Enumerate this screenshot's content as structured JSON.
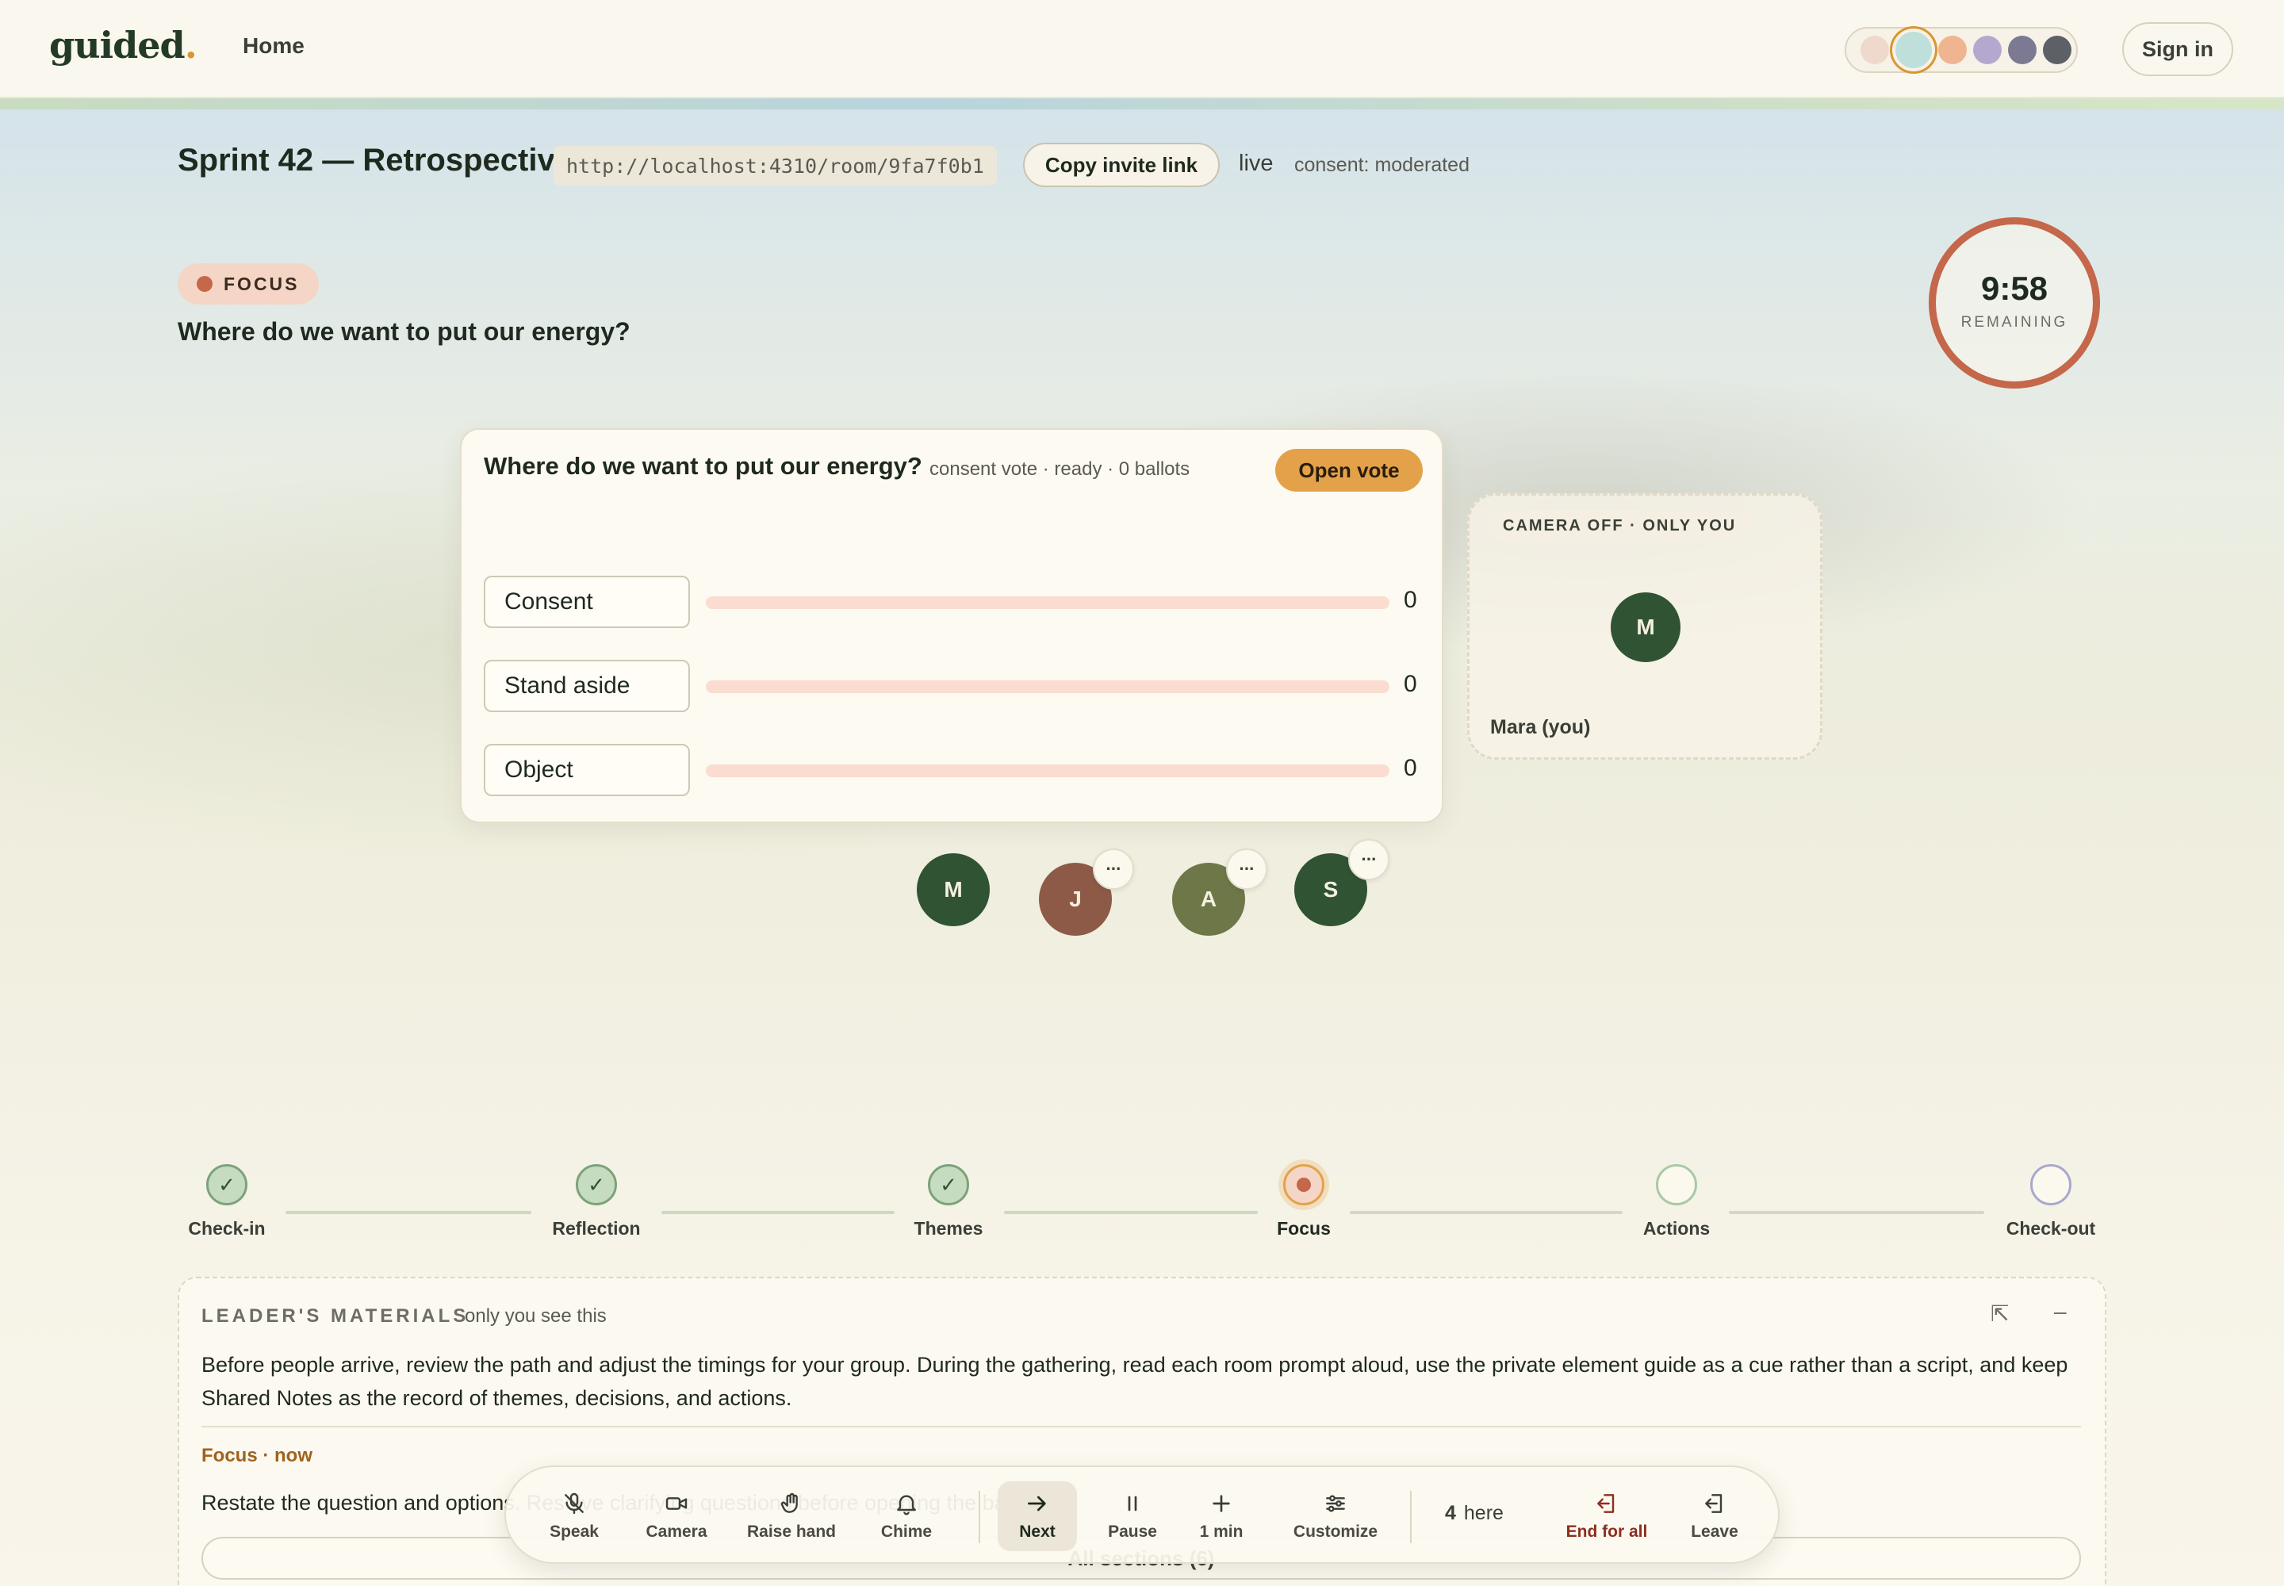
{
  "app": {
    "logo": "guided",
    "logo_dot": ".",
    "nav_home": "Home",
    "sign_in": "Sign in",
    "theme_swatches": [
      "#eed9cc",
      "#bfe0da",
      "#efb590",
      "#b5a8cf",
      "#7b7a92",
      "#5e6068"
    ],
    "active_swatch": 1
  },
  "room": {
    "title": "Sprint 42 — Retrospective",
    "url": "http://localhost:4310/room/9fa7f0b1",
    "copy_link": "Copy invite link",
    "status": "live",
    "consent_mode": "consent: moderated"
  },
  "stage": {
    "pill": "FOCUS",
    "question": "Where do we want to put our energy?",
    "timer": {
      "time": "9:58",
      "label": "REMAINING"
    }
  },
  "vote": {
    "question": "Where do we want to put our energy?",
    "meta": "consent vote · ready · 0 ballots",
    "open_button": "Open vote",
    "options": [
      {
        "label": "Consent",
        "count": "0",
        "share": 0
      },
      {
        "label": "Stand aside",
        "count": "0",
        "share": 0
      },
      {
        "label": "Object",
        "count": "0",
        "share": 0
      }
    ]
  },
  "camera": {
    "badge": "CAMERA OFF · ONLY YOU",
    "initial": "M",
    "name": "Mara (you)"
  },
  "participants": [
    {
      "initial": "M",
      "color": "#2f5333",
      "more": ""
    },
    {
      "initial": "J",
      "color": "#8d5a47",
      "more": "···"
    },
    {
      "initial": "A",
      "color": "#6d7748",
      "more": "···"
    },
    {
      "initial": "S",
      "color": "#2f5333",
      "more": "···"
    }
  ],
  "path": {
    "steps": [
      {
        "label": "Check-in",
        "state": "done",
        "mark": "✓"
      },
      {
        "label": "Reflection",
        "state": "done",
        "mark": "✓"
      },
      {
        "label": "Themes",
        "state": "done",
        "mark": "✓"
      },
      {
        "label": "Focus",
        "state": "current",
        "mark": ""
      },
      {
        "label": "Actions",
        "state": "todo",
        "mark": ""
      },
      {
        "label": "Check-out",
        "state": "todo",
        "mark": ""
      }
    ]
  },
  "materials": {
    "heading": "LEADER'S MATERIALS",
    "subheading": "only you see this",
    "body": "Before people arrive, review the path and adjust the timings for your group. During the gathering, read each room prompt aloud, use the private element guide as a cue rather than a script, and keep Shared Notes as the record of themes, decisions, and actions.",
    "now_label": "Focus · now",
    "step_text": "Restate the question and options. Resolve clarifying questions before opening the ballot.",
    "all_sections": "All sections (6)"
  },
  "controls": {
    "speak": "Speak",
    "camera": "Camera",
    "raise_hand": "Raise hand",
    "chime": "Chime",
    "next": "Next",
    "pause": "Pause",
    "add_time": "1 min",
    "customize": "Customize",
    "here_count": "4",
    "here_label": "here",
    "end_for_all": "End for all",
    "leave": "Leave"
  }
}
